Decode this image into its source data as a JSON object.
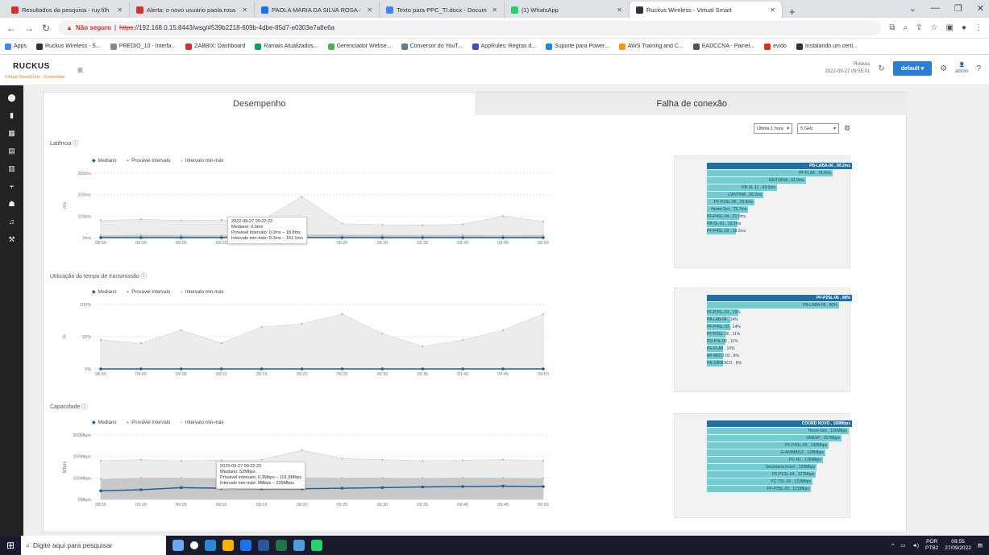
{
  "browser": {
    "tabs": [
      {
        "label": "Resultados da pesquisa - ruy.filh",
        "color": "#d93025"
      },
      {
        "label": "Alerta: o novo usuário paola.rosa",
        "color": "#d93025"
      },
      {
        "label": "PAOLA MARIA DA SILVA ROSA -",
        "color": "#1a73e8"
      },
      {
        "label": "Texto para PPC_TI.docx - Docum",
        "color": "#4285f4"
      },
      {
        "label": "(1) WhatsApp",
        "color": "#25d366"
      },
      {
        "label": "Ruckus Wireless - Virtual Smart",
        "color": "#333333"
      }
    ],
    "url_warning": "Não seguro",
    "url_scheme": "https",
    "url_rest": "://192.168.0.15:8443/wsg/#539b2218-609b-4dbe-85d7-e0303e7a8e6a",
    "bookmarks": [
      {
        "label": "Apps",
        "color": "#4285f4"
      },
      {
        "label": "Ruckus Wireless - S...",
        "color": "#333333"
      },
      {
        "label": "PREDIO_10 - Interfa...",
        "color": "#888888"
      },
      {
        "label": "ZABBIX: Dashboard",
        "color": "#d32f2f"
      },
      {
        "label": "Ramais Atualizados...",
        "color": "#0f9d58"
      },
      {
        "label": "Gerenciador Webse...",
        "color": "#4caf50"
      },
      {
        "label": "Conversor do YouT...",
        "color": "#607d8b"
      },
      {
        "label": "AppRules: Regras d...",
        "color": "#3f51b5"
      },
      {
        "label": "Suporte para Power...",
        "color": "#1e88e5"
      },
      {
        "label": "AWS Training and C...",
        "color": "#ff9800"
      },
      {
        "label": "EADCCNA - Painel...",
        "color": "#555555"
      },
      {
        "label": "evido",
        "color": "#d93025"
      },
      {
        "label": "Instalando um certi...",
        "color": "#333333"
      }
    ]
  },
  "app": {
    "logo": "RUCKUS",
    "subtitle": "Virtual SmartZone - Essentials",
    "ruckus_label": "Ruckus",
    "datetime": "2022-09-27  09:55:01",
    "zone_button": "default",
    "user": "admin"
  },
  "tabs": {
    "performance": "Desempenho",
    "connection_failure": "Falha de conexão"
  },
  "filters": {
    "time": "Última 1 hora",
    "band": "5 GHz"
  },
  "legend": {
    "median": "Mediano",
    "probable": "Provável Intervalo",
    "minmax": "Intervalo min-máx"
  },
  "x_ticks": [
    "08:55",
    "09:00",
    "09:05",
    "09:10",
    "09:15",
    "09:20",
    "09:25",
    "09:30",
    "09:35",
    "09:40",
    "09:45",
    "09:50"
  ],
  "latency": {
    "title": "Latência",
    "yunit": "ms",
    "y_ticks": [
      "300ms",
      "200ms",
      "100ms",
      "0ms"
    ],
    "tooltip": [
      "2022-09-27 09:22:23",
      "Mediano: 0.0ms",
      "Provável intervalo: 0.0ms – 18.8ms",
      "Intervalo min-máx: 0.0ms – 191.1ms"
    ],
    "top": [
      {
        "label": "PB-LABA-06 , 90.2ms",
        "value": 90.2,
        "dark": true
      },
      {
        "label": "PF-FLA8 , 78.4ms",
        "value": 78.4
      },
      {
        "label": "REITORIA , 61.5ms",
        "value": 61.5
      },
      {
        "label": "PB-SL-11 , 43.6ms",
        "value": 43.6
      },
      {
        "label": "CANTINA , 35.3ms",
        "value": 35.3
      },
      {
        "label": "PF-P2SL-05 , 29.6ms",
        "value": 29.6
      },
      {
        "label": "Hovet-Sec , 25.7ms",
        "value": 25.7
      },
      {
        "label": "PF-P4SL-04 , 20.0ms",
        "value": 20.0
      },
      {
        "label": "PB-SL-01 , 19.2ms",
        "value": 19.2
      },
      {
        "label": "PF-P4SL-02 , 18.2ms",
        "value": 18.2
      }
    ]
  },
  "airtime": {
    "title": "Utilização do tempo de transmissão",
    "yunit": "%",
    "y_ticks": [
      "100%",
      "50%",
      "0%"
    ],
    "top": [
      {
        "label": "PF-P2SL-05 , 88%",
        "value": 88,
        "dark": true
      },
      {
        "label": "PB-LABA-06 , 80%",
        "value": 80
      },
      {
        "label": "PF-P3SL-03 , 19%",
        "value": 19
      },
      {
        "label": "PA-LAB-04 , 14%",
        "value": 14
      },
      {
        "label": "PF-P4SL-02 , 14%",
        "value": 14
      },
      {
        "label": "PF-P2SL-05 , 11%",
        "value": 11
      },
      {
        "label": "PD-P3L-08 , 11%",
        "value": 11
      },
      {
        "label": "PE-FLA8 , 10%",
        "value": 10
      },
      {
        "label": "AP-MOCI-02 , 8%",
        "value": 8
      },
      {
        "label": "PA-JURIDICO , 6%",
        "value": 6
      }
    ]
  },
  "capacity": {
    "title": "Capacidade",
    "yunit": "Mbps",
    "y_ticks": [
      "300Mbps",
      "200Mbps",
      "100Mbps",
      "0Mbps"
    ],
    "tooltip": [
      "2022-09-27 09:22:23",
      "Mediano: 52Mbps",
      "Provável intervalo: 0.3Mbps – 101.8Mbps",
      "Intervalo min-máx: 0Mbps – 229Mbps"
    ],
    "top": [
      {
        "label": "COORD NOVO , 169Mbps",
        "value": 169,
        "dark": true
      },
      {
        "label": "Hovet-Sec , 165Mbps",
        "value": 165
      },
      {
        "label": "UNESP , 157Mbps",
        "value": 157
      },
      {
        "label": "PF-P3SL-05 , 142Mbps",
        "value": 142
      },
      {
        "label": "G-ANIMAIS2 , 138Mbps",
        "value": 138
      },
      {
        "label": "PC-N1 , 135Mbps",
        "value": 135
      },
      {
        "label": "Secretaria-hovet , 128Mbps",
        "value": 128
      },
      {
        "label": "PF-P1SL-04 , 127Mbps",
        "value": 127
      },
      {
        "label": "PC-TSL-03 , 123Mbps",
        "value": 123
      },
      {
        "label": "PF-P3SL-03 , 121Mbps",
        "value": 121
      }
    ]
  },
  "chart_data": [
    {
      "type": "area",
      "title": "Latência",
      "ylabel": "ms",
      "ylim": [
        0,
        300
      ],
      "x": [
        "08:55",
        "09:00",
        "09:05",
        "09:10",
        "09:15",
        "09:20",
        "09:25",
        "09:30",
        "09:35",
        "09:40",
        "09:45",
        "09:50"
      ],
      "series": [
        {
          "name": "Mediano",
          "values": [
            0,
            0,
            0,
            0,
            0,
            0,
            0,
            0,
            0,
            0,
            0,
            0
          ]
        },
        {
          "name": "Provável Intervalo",
          "values": [
            10,
            12,
            11,
            10,
            12,
            14,
            13,
            12,
            11,
            12,
            10,
            12
          ]
        },
        {
          "name": "Intervalo min-máx",
          "values": [
            80,
            85,
            80,
            82,
            80,
            190,
            65,
            60,
            58,
            62,
            100,
            75
          ]
        }
      ]
    },
    {
      "type": "area",
      "title": "Utilização do tempo de transmissão",
      "ylabel": "%",
      "ylim": [
        0,
        100
      ],
      "x": [
        "08:55",
        "09:00",
        "09:05",
        "09:10",
        "09:15",
        "09:20",
        "09:25",
        "09:30",
        "09:35",
        "09:40",
        "09:45",
        "09:50"
      ],
      "series": [
        {
          "name": "Mediano",
          "values": [
            0,
            0,
            0,
            0,
            0,
            0,
            0,
            0,
            0,
            0,
            0,
            0
          ]
        },
        {
          "name": "Intervalo min-máx",
          "values": [
            45,
            40,
            60,
            40,
            65,
            70,
            85,
            55,
            35,
            45,
            60,
            85
          ]
        }
      ]
    },
    {
      "type": "area",
      "title": "Capacidade",
      "ylabel": "Mbps",
      "ylim": [
        0,
        300
      ],
      "x": [
        "08:55",
        "09:00",
        "09:05",
        "09:10",
        "09:15",
        "09:20",
        "09:25",
        "09:30",
        "09:35",
        "09:40",
        "09:45",
        "09:50"
      ],
      "series": [
        {
          "name": "Mediano",
          "values": [
            40,
            45,
            55,
            52,
            50,
            50,
            52,
            55,
            58,
            60,
            62,
            60
          ]
        },
        {
          "name": "Provável Intervalo",
          "values": [
            95,
            100,
            100,
            98,
            100,
            101,
            100,
            100,
            99,
            100,
            100,
            98
          ]
        },
        {
          "name": "Intervalo min-máx",
          "values": [
            180,
            185,
            180,
            182,
            185,
            229,
            190,
            185,
            180,
            182,
            185,
            180
          ]
        }
      ]
    }
  ],
  "taskbar": {
    "search_placeholder": "Digite aqui para pesquisar",
    "lang": "POR",
    "layout": "PTB2",
    "time": "09:55",
    "date": "27/09/2022"
  }
}
